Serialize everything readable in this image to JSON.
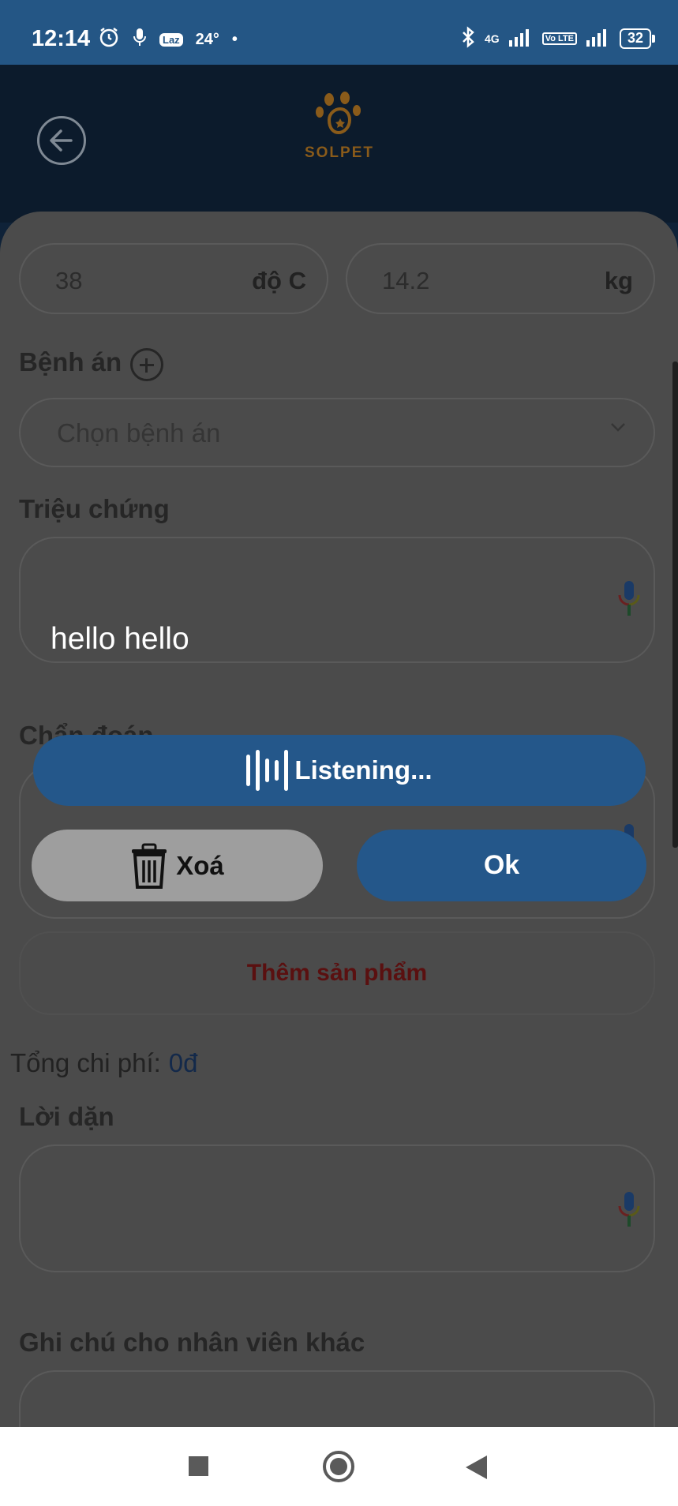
{
  "status_bar": {
    "time": "12:14",
    "temperature": "24°",
    "laz_badge": "Laz",
    "network_label": "4G",
    "volte_label": "Vo LTE",
    "battery": "32"
  },
  "header": {
    "brand": "SOLPET"
  },
  "vitals": {
    "temperature_value": "38",
    "temperature_unit": "độ C",
    "weight_value": "14.2",
    "weight_unit": "kg"
  },
  "medical_record": {
    "label": "Bệnh án",
    "placeholder": "Chọn bệnh án"
  },
  "symptoms": {
    "label": "Triệu chứng",
    "value": "hello hello"
  },
  "diagnosis": {
    "label": "Chẩn đoán"
  },
  "add_product": {
    "label": "Thêm sản phẩm"
  },
  "total": {
    "label": "Tổng chi phí:",
    "amount": "0đ"
  },
  "instructions": {
    "label": "Lời dặn"
  },
  "staff_note": {
    "label": "Ghi chú cho nhân viên khác"
  },
  "speech_dialog": {
    "listening_label": "Listening...",
    "delete_label": "Xoá",
    "ok_label": "Ok"
  },
  "colors": {
    "primary": "#24578a",
    "status_bar": "#245685",
    "header": "#0c1b2c",
    "logo": "#d4841c",
    "delete_button": "#9e9e9e"
  }
}
